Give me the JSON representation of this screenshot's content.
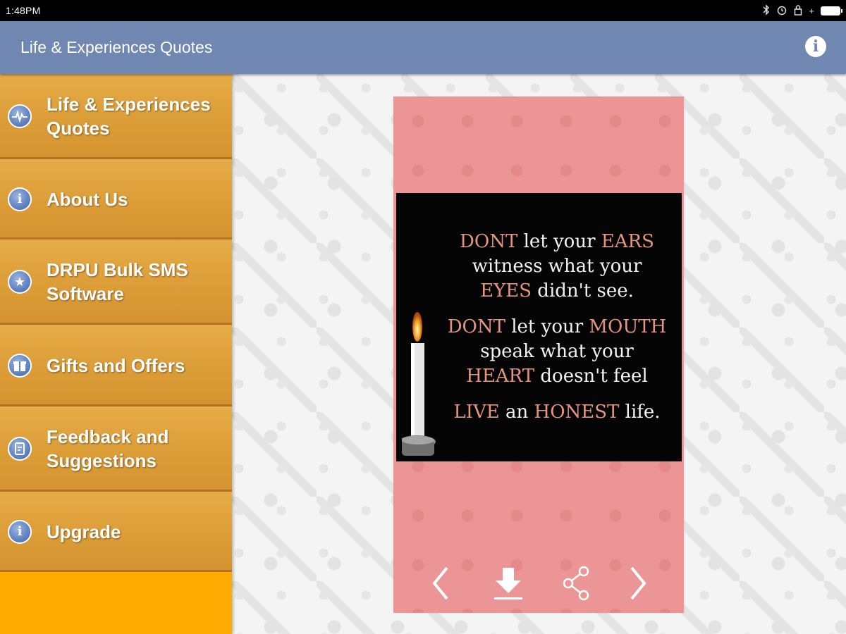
{
  "status_bar": {
    "time": "1:48PM"
  },
  "app_bar": {
    "title": "Life & Experiences Quotes",
    "info_icon": "info-icon"
  },
  "drawer": {
    "items": [
      {
        "label": "Life & Experiences Quotes",
        "icon": "pulse-icon"
      },
      {
        "label": "About Us",
        "icon": "info-icon"
      },
      {
        "label": "DRPU Bulk SMS Software",
        "icon": "star-icon"
      },
      {
        "label": "Gifts and Offers",
        "icon": "gift-icon"
      },
      {
        "label": "Feedback and Suggestions",
        "icon": "feedback-icon"
      },
      {
        "label": "Upgrade",
        "icon": "info-icon"
      }
    ]
  },
  "quote": {
    "l1a": "DONT",
    "l1b": " let your ",
    "l1c": "EARS",
    "l2": "witness what your",
    "l3a": "EYES",
    "l3b": " didn't see.",
    "l4a": "DONT",
    "l4b": " let your ",
    "l4c": "MOUTH",
    "l5": "speak what your",
    "l6a": "HEART",
    "l6b": " doesn't feel",
    "l7a": "LIVE",
    "l7b": " an ",
    "l7c": "HONEST",
    "l7d": " life."
  },
  "controls": [
    "previous-icon",
    "download-icon",
    "share-icon",
    "next-icon"
  ],
  "colors": {
    "app_bar": "#6f87b1",
    "drawer_item": "#dc9d37",
    "drawer_bottom": "#ffaa00",
    "card": "#ec9596",
    "quote_highlight": "#e5957e"
  }
}
